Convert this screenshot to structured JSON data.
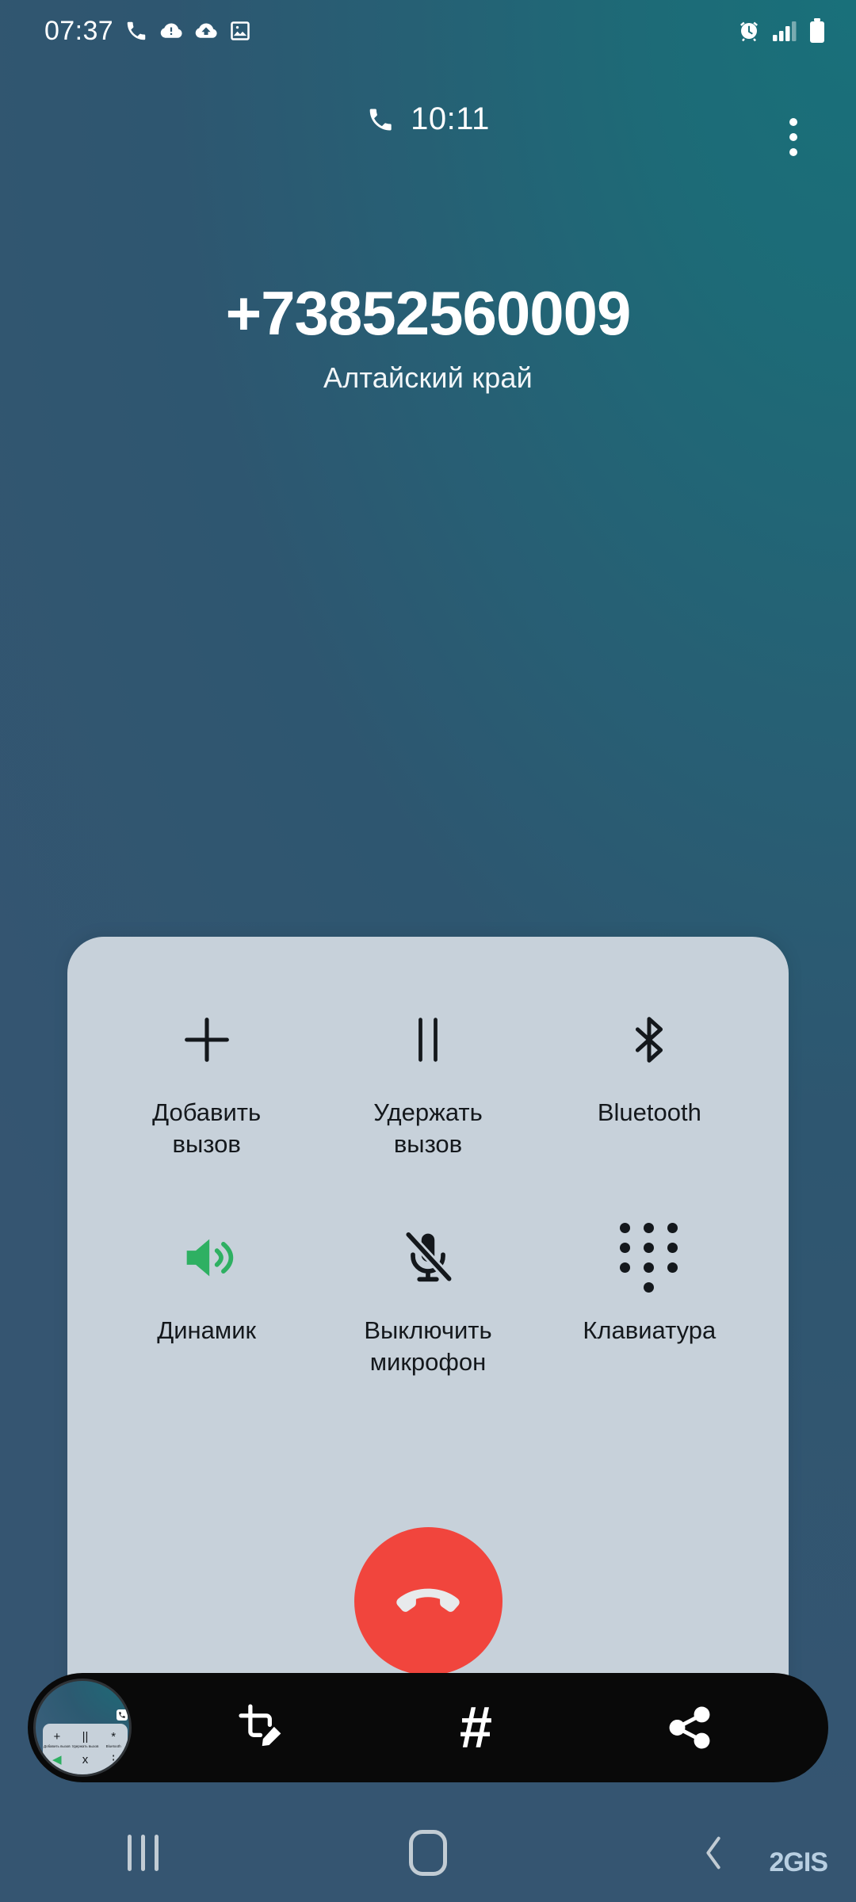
{
  "status_bar": {
    "time": "07:37",
    "left_icons": [
      "phone-icon",
      "cloud-alert-icon",
      "cloud-upload-icon",
      "image-icon"
    ],
    "right_icons": [
      "alarm-icon",
      "signal-bars-icon",
      "battery-icon"
    ],
    "signal_bars_filled": 3,
    "signal_bars_total": 4
  },
  "call_header": {
    "duration": "10:11",
    "call_state_icon": "phone-icon",
    "overflow_icon": "more-vertical-icon"
  },
  "caller": {
    "number": "+73852560009",
    "location": "Алтайский край"
  },
  "controls": {
    "row1": [
      {
        "label": "Добавить\nвызов",
        "icon": "plus-icon",
        "active": false
      },
      {
        "label": "Удержать\nвызов",
        "icon": "pause-icon",
        "active": false
      },
      {
        "label": "Bluetooth",
        "icon": "bluetooth-icon",
        "active": false
      }
    ],
    "row2": [
      {
        "label": "Динамик",
        "icon": "speaker-icon",
        "active": true
      },
      {
        "label": "Выключить\nмикрофон",
        "icon": "mic-off-icon",
        "active": false
      },
      {
        "label": "Клавиатура",
        "icon": "dialpad-icon",
        "active": false
      }
    ],
    "end_call": {
      "icon": "end-call-icon",
      "label": ""
    }
  },
  "screenshot_toolbar": {
    "thumbnail_icon": "screenshot-thumbnail",
    "actions": [
      {
        "icon": "crop-edit-icon"
      },
      {
        "icon": "hash-icon",
        "glyph": "#"
      },
      {
        "icon": "share-icon"
      }
    ],
    "thumb_mini_labels": [
      "Добавить вызов",
      "Удержать вызов",
      "Bluetooth"
    ],
    "thumb_mini_icons": [
      "+",
      "||",
      "*"
    ]
  },
  "nav_bar": {
    "items": [
      {
        "icon": "recents-icon"
      },
      {
        "icon": "home-icon"
      },
      {
        "icon": "back-icon"
      }
    ]
  },
  "watermark": {
    "text": "2GIS"
  },
  "colors": {
    "accent_green": "#2eb062",
    "end_call_red": "#f1453d",
    "panel_bg": "#c7d1da",
    "toolbar_bg": "#090909",
    "bg_teal": "#1d6f79",
    "bg_blue": "#3a5f7b",
    "watermark": "#b8cfe2"
  }
}
